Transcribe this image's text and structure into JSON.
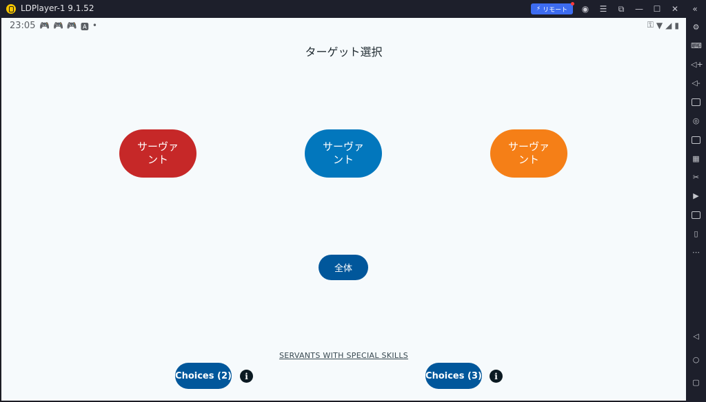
{
  "window": {
    "title": "LDPlayer-1 9.1.52",
    "remote_label": "リモート",
    "controls": [
      "account-icon",
      "menu-icon",
      "external-icon",
      "minimize-icon",
      "maximize-icon",
      "close-icon",
      "collapse-icon"
    ]
  },
  "status_bar": {
    "time": "23:05",
    "icons": [
      "gamepad-icon",
      "gamepad-icon",
      "gamepad-icon",
      "font-icon",
      "dot-icon"
    ],
    "right_icons": [
      "key-icon",
      "wifi-icon",
      "signal-icon",
      "battery-icon"
    ]
  },
  "main": {
    "title": "ターゲット選択",
    "servants": [
      {
        "label": "サーヴァント",
        "color": "#c62828"
      },
      {
        "label": "サーヴァント",
        "color": "#0277bd"
      },
      {
        "label": "サーヴァント",
        "color": "#f57f17"
      }
    ],
    "all_button": "全体",
    "special_skills_link": "SERVANTS WITH SPECIAL SKILLS",
    "choices": [
      {
        "label": "Choices (2)"
      },
      {
        "label": "Choices (3)"
      }
    ]
  },
  "sidebar": {
    "icons": [
      "settings-icon",
      "keyboard-icon",
      "volume-up-icon",
      "volume-down-icon",
      "screenshot-icon",
      "location-icon",
      "apk-icon",
      "operations-icon",
      "scissors-icon",
      "record-icon",
      "file-icon",
      "shake-icon",
      "more-icon",
      "back-icon",
      "home-icon",
      "recents-icon"
    ]
  }
}
